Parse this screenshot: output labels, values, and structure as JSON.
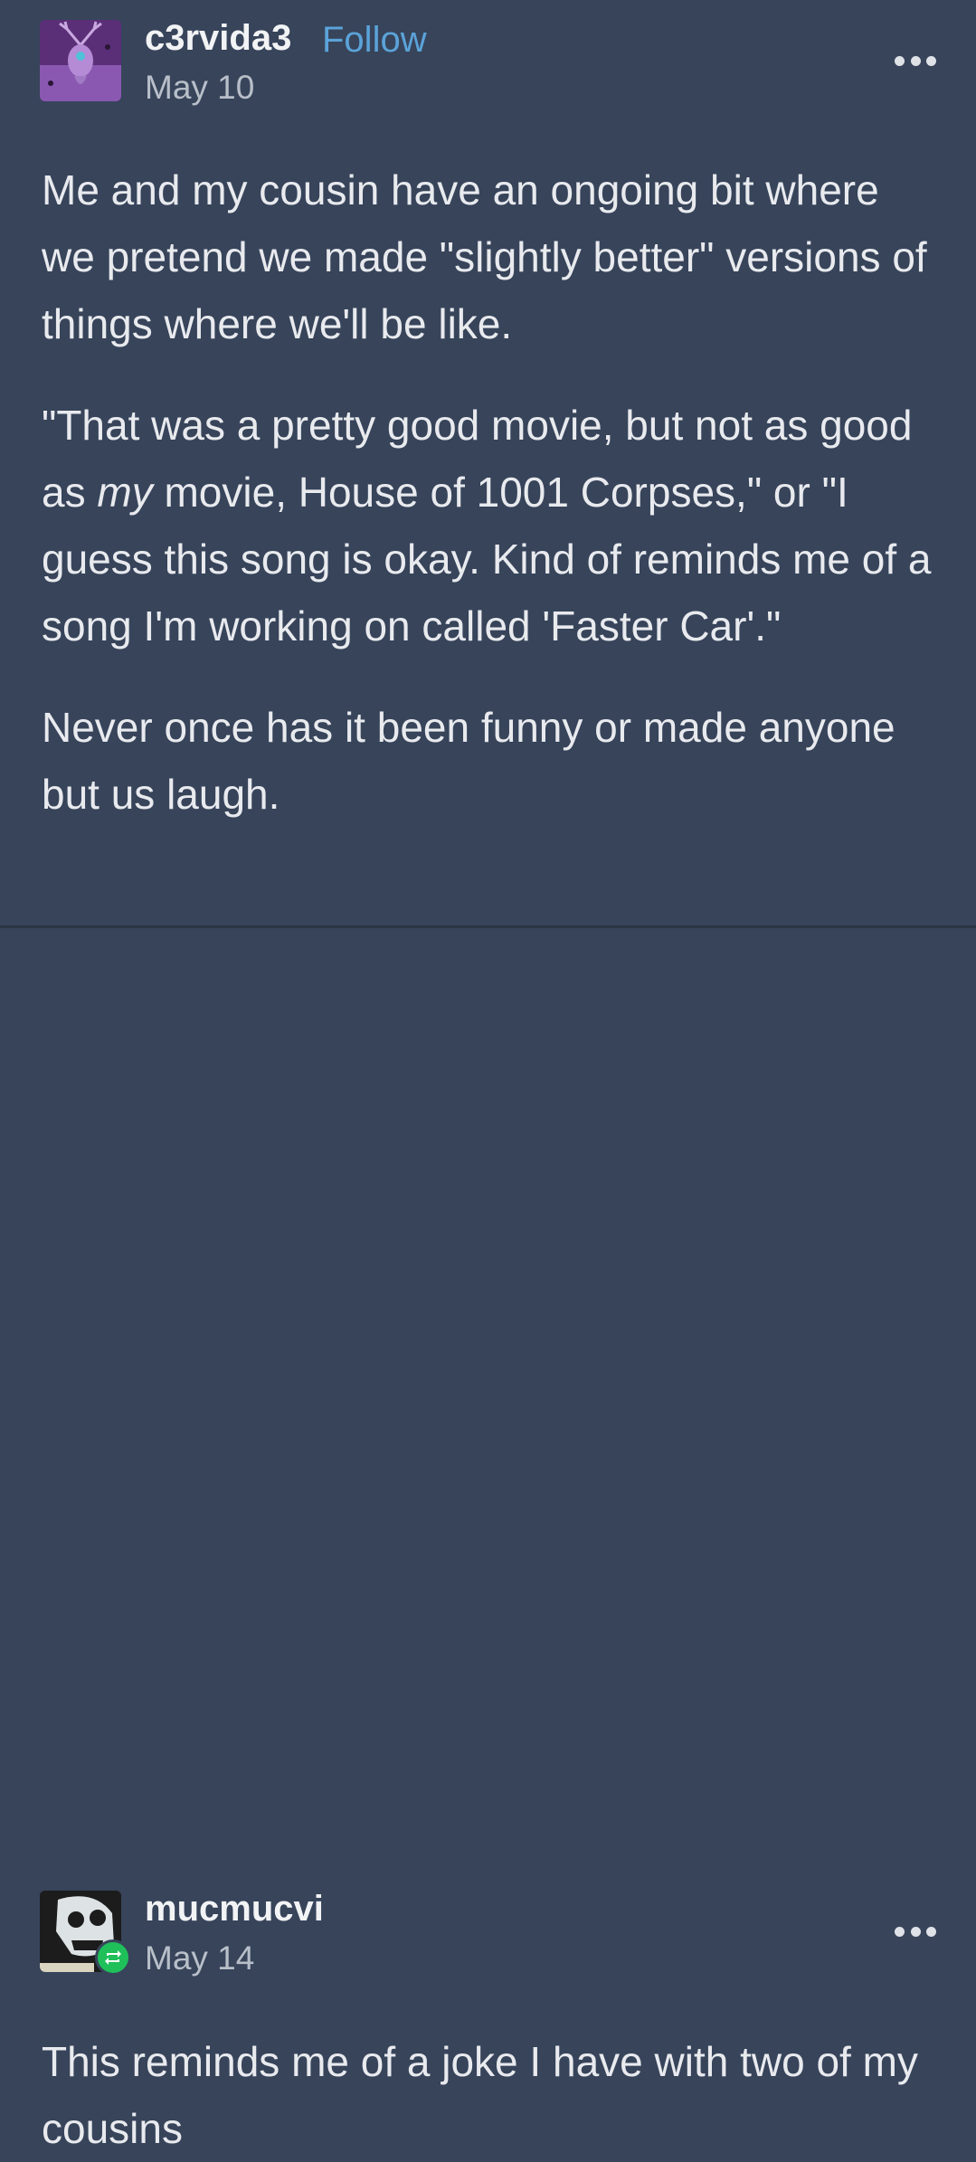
{
  "posts": [
    {
      "username": "c3rvida3",
      "follow_label": "Follow",
      "date": "May 10",
      "paragraphs": [
        "Me and my cousin have an ongoing bit where we pretend we made \"slightly better\" versions of things where we'll be like.",
        "\"That was a pretty good movie, but not as good as",
        "my",
        "movie, House of 1001 Corpses,\" or \"I guess this song is okay. Kind of reminds me of a song I'm working on called 'Faster Car'.\"",
        "Never once has it been funny or made anyone but us laugh."
      ]
    },
    {
      "username": "mucmucvi",
      "date": "May 14",
      "paragraphs": [
        "This reminds me of a joke I have with two of my cousins"
      ]
    }
  ],
  "icons": {
    "more": "more-options-icon",
    "reblog": "reblog-icon"
  },
  "colors": {
    "background": "#37445a",
    "follow": "#5ba3d9",
    "reblog_badge": "#1fbf5a"
  }
}
